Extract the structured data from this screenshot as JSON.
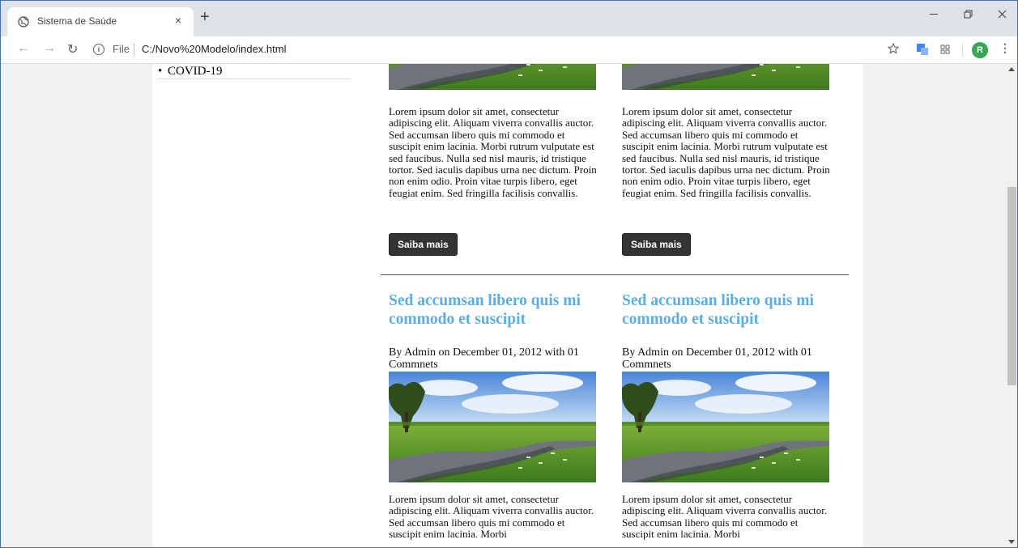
{
  "browser": {
    "tab_title": "Sistema de Saúde",
    "tab_close": "×",
    "new_tab": "+",
    "scheme": "File",
    "url": "C:/Novo%20Modelo/index.html",
    "profile_initial": "R"
  },
  "sidebar": {
    "items": [
      {
        "label": "COVID-19"
      }
    ]
  },
  "posts_top": [
    {
      "body": "Lorem ipsum dolor sit amet, consectetur adipiscing elit. Aliquam viverra convallis auctor. Sed accumsan libero quis mi commodo et suscipit enim lacinia. Morbi rutrum vulputate est sed faucibus. Nulla sed nisl mauris, id tristique tortor. Sed iaculis dapibus urna nec dictum. Proin non enim odio. Proin vitae turpis libero, eget feugiat enim. Sed fringilla facilisis convallis.",
      "button": "Saiba mais"
    },
    {
      "body": "Lorem ipsum dolor sit amet, consectetur adipiscing elit. Aliquam viverra convallis auctor. Sed accumsan libero quis mi commodo et suscipit enim lacinia. Morbi rutrum vulputate est sed faucibus. Nulla sed nisl mauris, id tristique tortor. Sed iaculis dapibus urna nec dictum. Proin non enim odio. Proin vitae turpis libero, eget feugiat enim. Sed fringilla facilisis convallis.",
      "button": "Saiba mais"
    }
  ],
  "posts_bottom": [
    {
      "title": "Sed accumsan libero quis mi commodo et suscipit",
      "byline": "By Admin on December 01, 2012 with 01 Commnets",
      "body": "Lorem ipsum dolor sit amet, consectetur adipiscing elit. Aliquam viverra convallis auctor. Sed accumsan libero quis mi commodo et suscipit enim lacinia. Morbi"
    },
    {
      "title": "Sed accumsan libero quis mi commodo et suscipit",
      "byline": "By Admin on December 01, 2012 with 01 Commnets",
      "body": "Lorem ipsum dolor sit amet, consectetur adipiscing elit. Aliquam viverra convallis auctor. Sed accumsan libero quis mi commodo et suscipit enim lacinia. Morbi"
    }
  ],
  "colors": {
    "title": "#5aaee6",
    "button": "#333333",
    "accent": "#3c6fc4"
  }
}
